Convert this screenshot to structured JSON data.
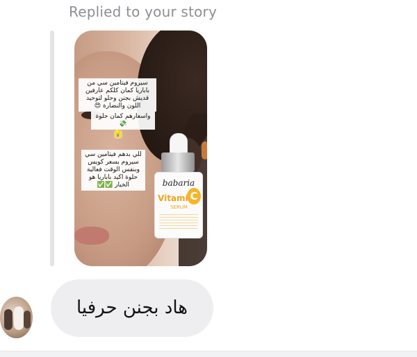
{
  "reply_header": {
    "text": "Replied to your story"
  },
  "story": {
    "caption_line1": "سيروم فيتامين سي من باباريا كمان كلكم عارفين قديش بجنن وحلو لتوحيد اللون والنضارة 😍",
    "caption_line2": "واسعارهم كمان حلوة 💸",
    "caption_line3": "💡",
    "caption_line4": "للي بدهم فيتامين سي سيروم بسعر كويس وبنفس الوقت فعالية حلوة اكيد باباريا هو الخيار ✅✅",
    "product": {
      "brand": "babaria",
      "name": "Vitamin",
      "letter": "C",
      "tag": "SERUM"
    }
  },
  "message": {
    "text": "هاد بجنن حرفيا"
  },
  "colors": {
    "bubble_bg": "#eeeef0",
    "label_gray": "#8e8e93",
    "reply_bar": "#e4e4e6",
    "accent_orange": "#f0a61a"
  }
}
